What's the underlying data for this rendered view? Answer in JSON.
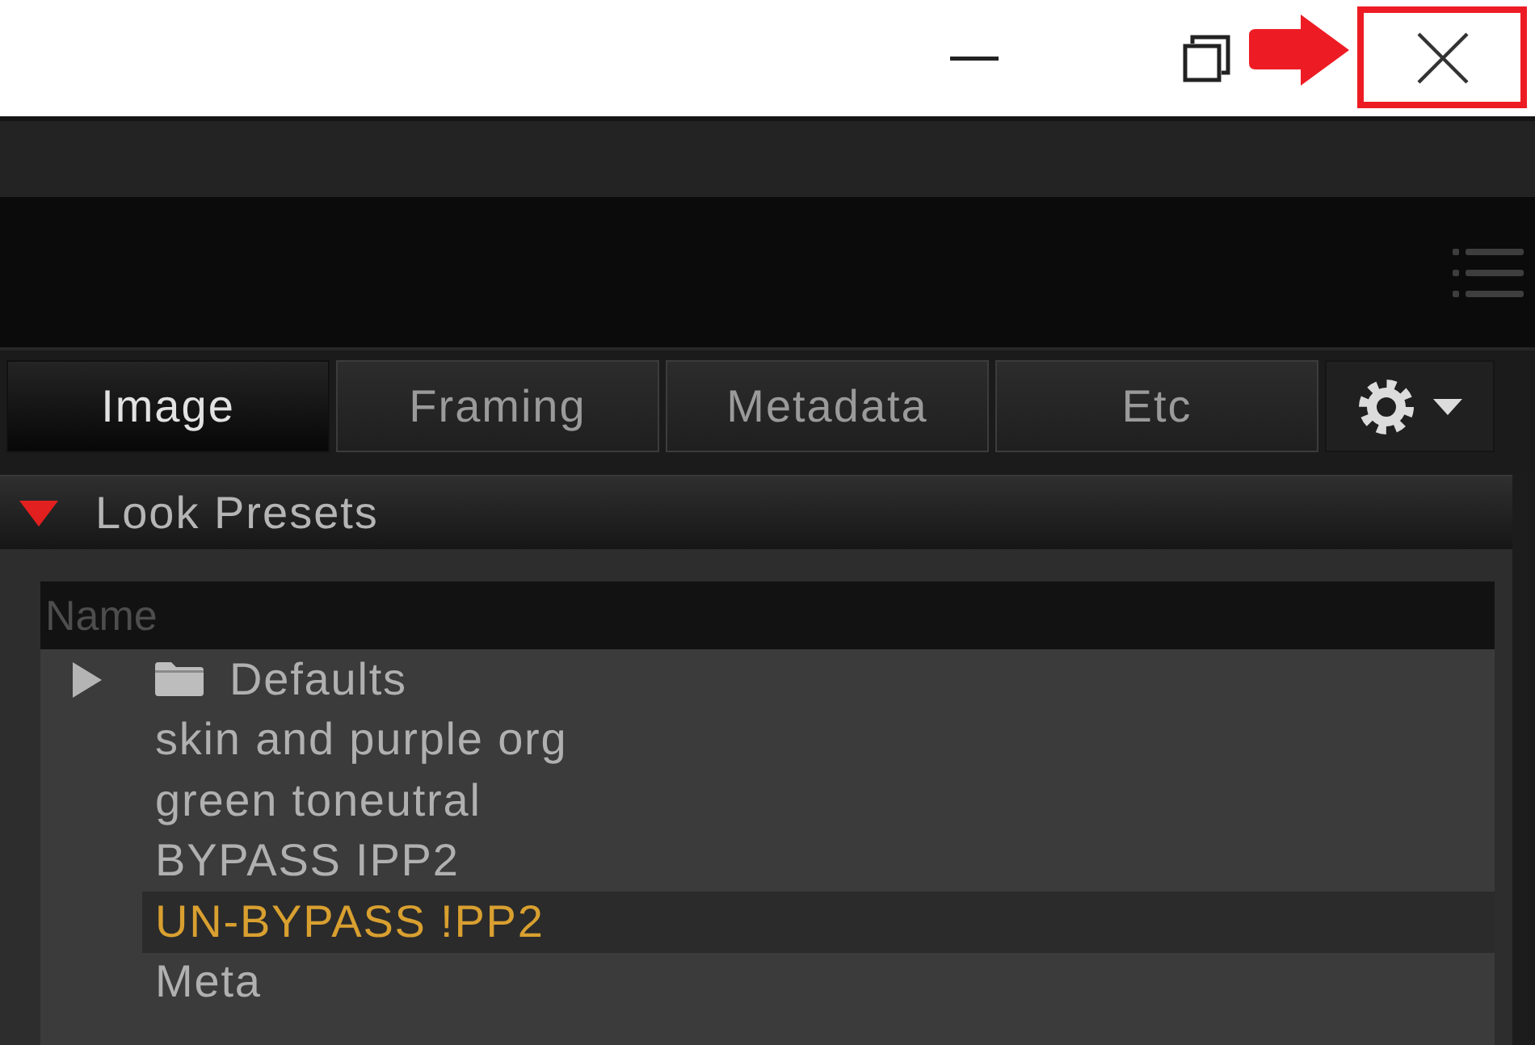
{
  "window": {
    "controls": [
      {
        "kind": "minimize"
      },
      {
        "kind": "restore"
      },
      {
        "kind": "close",
        "highlighted": true
      }
    ]
  },
  "tabs": [
    {
      "label": "Image",
      "selected": true
    },
    {
      "label": "Framing",
      "selected": false
    },
    {
      "label": "Metadata",
      "selected": false
    },
    {
      "label": "Etc",
      "selected": false
    }
  ],
  "section": {
    "title": "Look Presets",
    "expanded": true
  },
  "presets": {
    "column": "Name",
    "items": [
      {
        "kind": "folder",
        "label": "Defaults",
        "expanded": false,
        "selected": false
      },
      {
        "kind": "preset",
        "label": "skin and purple org",
        "selected": false
      },
      {
        "kind": "preset",
        "label": "green toneutral",
        "selected": false
      },
      {
        "kind": "preset",
        "label": "BYPASS IPP2",
        "selected": false
      },
      {
        "kind": "preset",
        "label": "UN-BYPASS !PP2",
        "selected": true
      },
      {
        "kind": "preset",
        "label": "Meta",
        "selected": false
      }
    ]
  }
}
